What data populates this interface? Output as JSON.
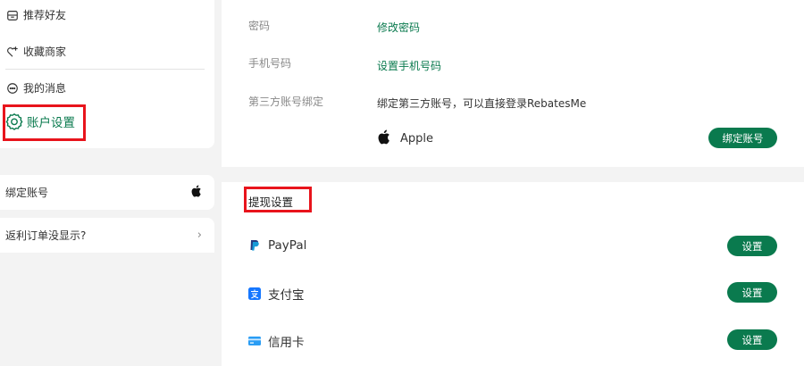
{
  "sidebar": {
    "menu": [
      {
        "label": "推荐好友",
        "icon": "gift-box-icon"
      },
      {
        "label": "收藏商家",
        "icon": "heart-plus-icon"
      },
      {
        "label": "我的消息",
        "icon": "chat-bubble-icon"
      }
    ],
    "active": {
      "label": "账户设置",
      "icon": "gear-icon"
    },
    "bind_account": {
      "label": "绑定账号",
      "icon": "apple-icon"
    },
    "rebate_missing": {
      "label": "返利订单没显示?",
      "icon": "chevron-right-icon"
    }
  },
  "account": {
    "password": {
      "label": "密码",
      "action": "修改密码"
    },
    "phone": {
      "label": "手机号码",
      "action": "设置手机号码"
    },
    "third_party": {
      "label": "第三方账号绑定",
      "description": "绑定第三方账号，可以直接登录RebatesMe",
      "provider": "Apple",
      "button": "绑定账号"
    }
  },
  "withdraw": {
    "title": "提现设置",
    "methods": [
      {
        "name": "PayPal",
        "icon": "paypal-icon",
        "button": "设置"
      },
      {
        "name": "支付宝",
        "icon": "alipay-icon",
        "button": "设置"
      },
      {
        "name": "信用卡",
        "icon": "credit-card-icon",
        "button": "设置"
      }
    ]
  },
  "colors": {
    "accent": "#0a7a4e",
    "highlight": "#e8141c",
    "background": "#f3f3f3"
  }
}
